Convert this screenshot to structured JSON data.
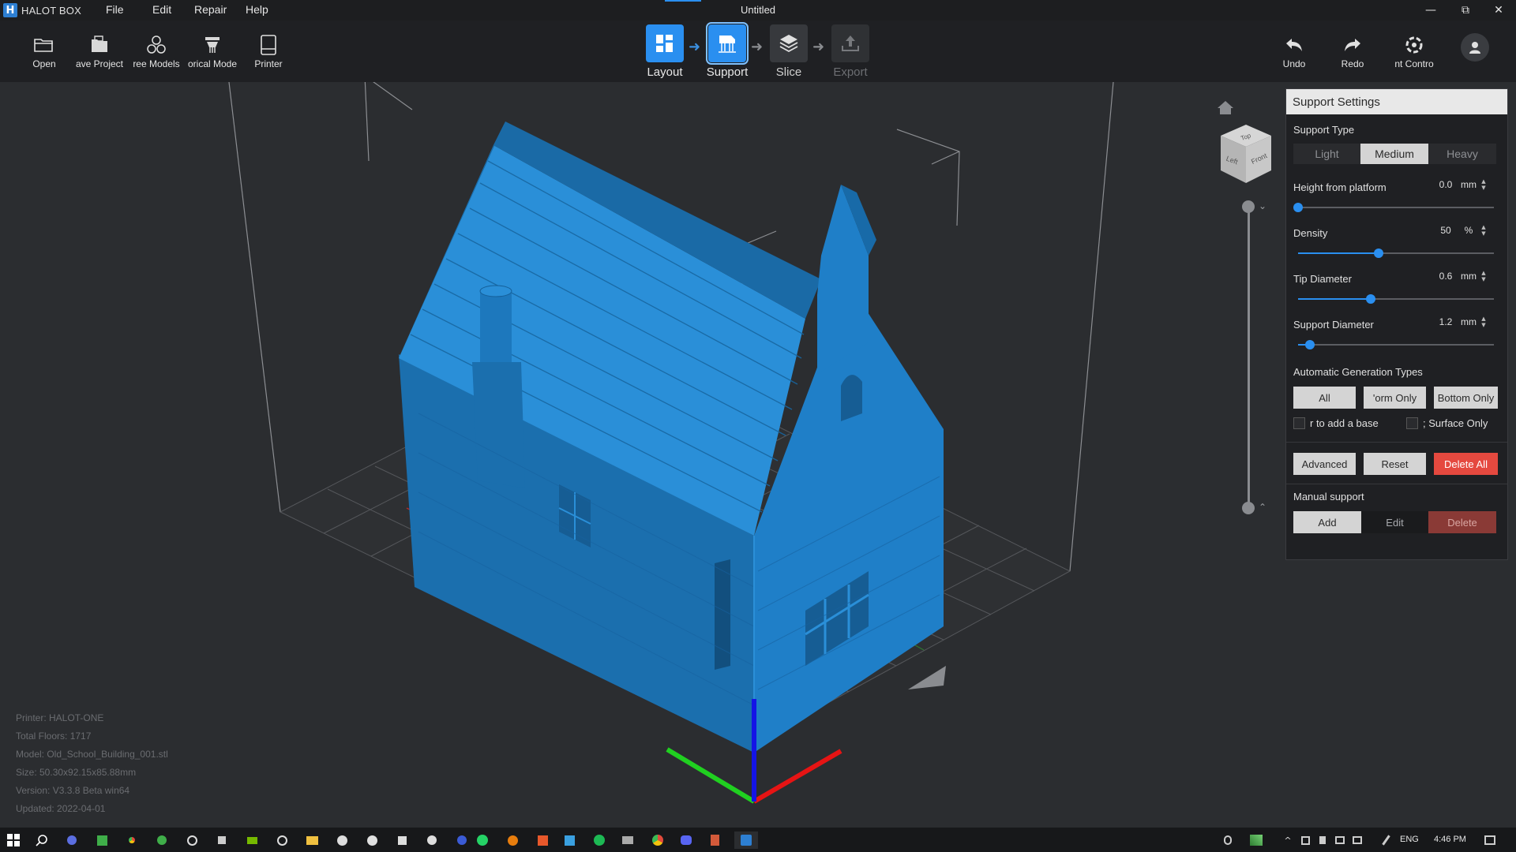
{
  "app": {
    "name": "HALOT BOX",
    "logo_letter": "H",
    "window_title": "Untitled",
    "menu": [
      "File",
      "Edit",
      "Repair",
      "Help"
    ],
    "window_controls": {
      "minimize": "—",
      "restore": "⧉",
      "close": "✕"
    }
  },
  "toolbar": {
    "left_tools": [
      {
        "label": "Open",
        "icon": "folder-open-icon"
      },
      {
        "label": "ave Project",
        "icon": "save-project-icon"
      },
      {
        "label": "ree Models",
        "icon": "free-models-icon"
      },
      {
        "label": "orical Mode",
        "icon": "historical-models-icon"
      },
      {
        "label": "Printer",
        "icon": "printer-icon"
      }
    ],
    "steps": [
      {
        "label": "Layout",
        "state": "done",
        "icon": "layout-icon"
      },
      {
        "label": "Support",
        "state": "active",
        "icon": "support-icon"
      },
      {
        "label": "Slice",
        "state": "pending",
        "icon": "slice-icon"
      },
      {
        "label": "Export",
        "state": "disabled",
        "icon": "export-icon"
      }
    ],
    "right_tools": [
      {
        "label": "Undo",
        "icon": "undo-icon"
      },
      {
        "label": "Redo",
        "icon": "redo-icon"
      },
      {
        "label": "nt Contro",
        "icon": "print-control-icon"
      }
    ],
    "avatar_icon": "user-avatar-icon"
  },
  "viewport": {
    "model_color": "#1f7fc8",
    "info": {
      "printer": "Printer: HALOT-ONE",
      "total_floors": "Total Floors: 1717",
      "model": "Model: Old_School_Building_001.stl",
      "size": "Size: 50.30x92.15x85.88mm",
      "version": "Version: V3.3.8 Beta win64",
      "updated": "Updated:  2022-04-01"
    },
    "view_cube": {
      "top": "Top",
      "left": "Left",
      "front": "Front"
    }
  },
  "support_settings": {
    "title": "Support Settings",
    "support_type_label": "Support Type",
    "support_types": [
      "Light",
      "Medium",
      "Heavy"
    ],
    "selected_type": "Medium",
    "height_from_platform": {
      "label": "Height from platform",
      "value": "0.0",
      "unit": "mm",
      "fraction": 0.0
    },
    "density": {
      "label": "Density",
      "value": "50",
      "unit": "%",
      "fraction": 0.41
    },
    "tip_diameter": {
      "label": "Tip Diameter",
      "value": "0.6",
      "unit": "mm",
      "fraction": 0.37
    },
    "support_diameter": {
      "label": "Support Diameter",
      "value": "1.2",
      "unit": "mm",
      "fraction": 0.06
    },
    "auto_gen_label": "Automatic Generation Types",
    "auto_gen_types": [
      "All",
      "'orm Only",
      "Bottom Only"
    ],
    "selected_auto_gen": "All",
    "add_base_label": "r to add a base",
    "surface_only_label": "; Surface Only",
    "advanced_label": "Advanced",
    "reset_label": "Reset",
    "delete_all_label": "Delete All",
    "manual_support_label": "Manual support",
    "manual_add": "Add",
    "manual_edit": "Edit",
    "manual_delete": "Delete",
    "accent": "#2a8ff0",
    "danger": "#e5493f"
  },
  "taskbar": {
    "tray_lang": "ENG",
    "time": "4:46 PM"
  }
}
